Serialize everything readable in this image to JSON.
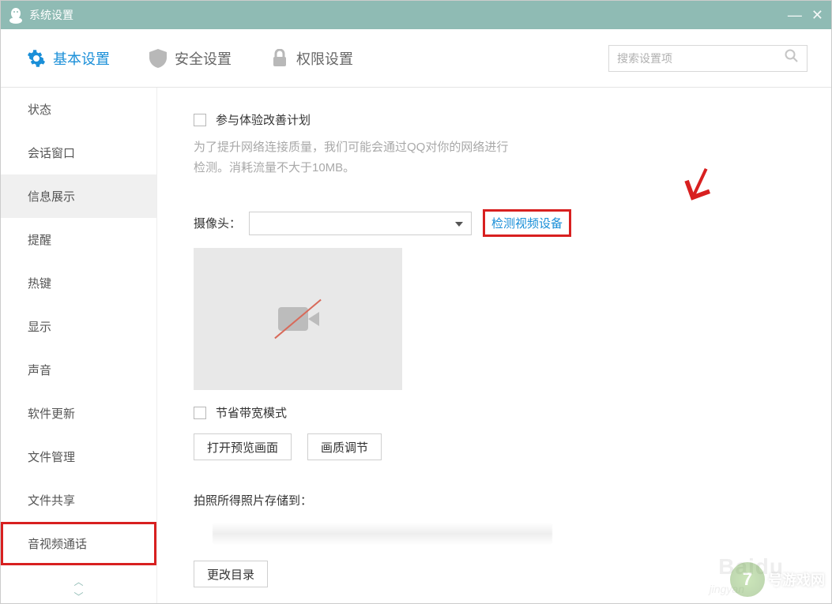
{
  "titlebar": {
    "title": "系统设置"
  },
  "tabs": [
    {
      "label": "基本设置",
      "active": true
    },
    {
      "label": "安全设置",
      "active": false
    },
    {
      "label": "权限设置",
      "active": false
    }
  ],
  "search": {
    "placeholder": "搜索设置项"
  },
  "sidebar": {
    "items": [
      {
        "label": "状态",
        "selected": false,
        "highlighted": false
      },
      {
        "label": "会话窗口",
        "selected": false,
        "highlighted": false
      },
      {
        "label": "信息展示",
        "selected": true,
        "highlighted": false
      },
      {
        "label": "提醒",
        "selected": false,
        "highlighted": false
      },
      {
        "label": "热键",
        "selected": false,
        "highlighted": false
      },
      {
        "label": "显示",
        "selected": false,
        "highlighted": false
      },
      {
        "label": "声音",
        "selected": false,
        "highlighted": false
      },
      {
        "label": "软件更新",
        "selected": false,
        "highlighted": false
      },
      {
        "label": "文件管理",
        "selected": false,
        "highlighted": false
      },
      {
        "label": "文件共享",
        "selected": false,
        "highlighted": false
      },
      {
        "label": "音视频通话",
        "selected": false,
        "highlighted": true
      }
    ]
  },
  "content": {
    "improvement_plan_label": "参与体验改善计划",
    "improvement_plan_desc": "为了提升网络连接质量，我们可能会通过QQ对你的网络进行检测。消耗流量不大于10MB。",
    "camera_label": "摄像头：",
    "detect_video_device": "检测视频设备",
    "bandwidth_saving_label": "节省带宽模式",
    "open_preview_btn": "打开预览画面",
    "quality_adjust_btn": "画质调节",
    "photo_storage_label": "拍照所得照片存储到：",
    "change_dir_btn": "更改目录"
  },
  "watermark": {
    "site_number": "7",
    "site_text": "号游戏网",
    "baidu": "Baidu",
    "jingyan": "jingyan"
  }
}
